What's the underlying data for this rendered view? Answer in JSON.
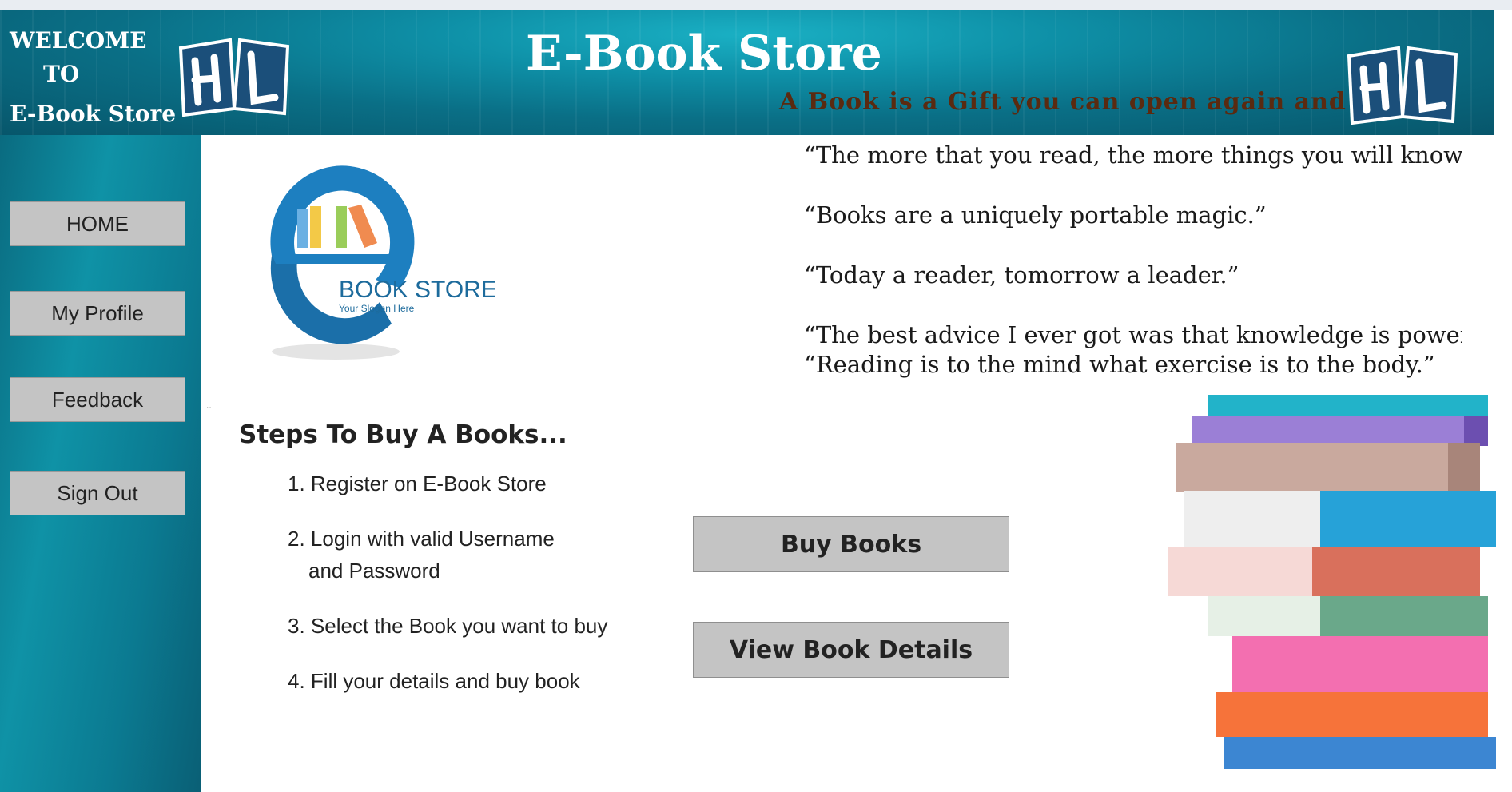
{
  "header": {
    "welcome_line1": "WELCOME",
    "welcome_line2": "TO",
    "welcome_line3": "E-Book Store",
    "title": "E-Book Store",
    "slogan": "A Book is a Gift you can open again and again",
    "logo_text": "HL"
  },
  "sidebar": {
    "items": [
      {
        "label": "HOME"
      },
      {
        "label": "My Profile"
      },
      {
        "label": "Feedback"
      },
      {
        "label": "Sign Out"
      }
    ]
  },
  "logo": {
    "letter": "e",
    "name": "BOOK STORE",
    "tagline": "Your Slogan Here"
  },
  "quotes": [
    "“The more that you read, the more things you will know.",
    "“Books are a uniquely portable magic.”",
    "“Today a reader, tomorrow a leader.”",
    "“The best advice I ever got was that knowledge is power and to",
    "“Reading is to the mind what exercise is to the body.”"
  ],
  "steps": {
    "title": "Steps To Buy A Books...",
    "items": [
      "1. Register on E-Book Store",
      "2. Login with valid Username",
      "and Password",
      "3. Select the Book you want to buy",
      "4. Fill your details and buy book"
    ]
  },
  "actions": {
    "buy_label": "Buy Books",
    "view_label": "View Book Details"
  },
  "misc": {
    "dots": ".."
  },
  "colors": {
    "header_bg": "#0a6f86",
    "sidebar_bg": "#0f92a6",
    "button_bg": "#c4c4c4",
    "slogan": "#5a2a10"
  }
}
